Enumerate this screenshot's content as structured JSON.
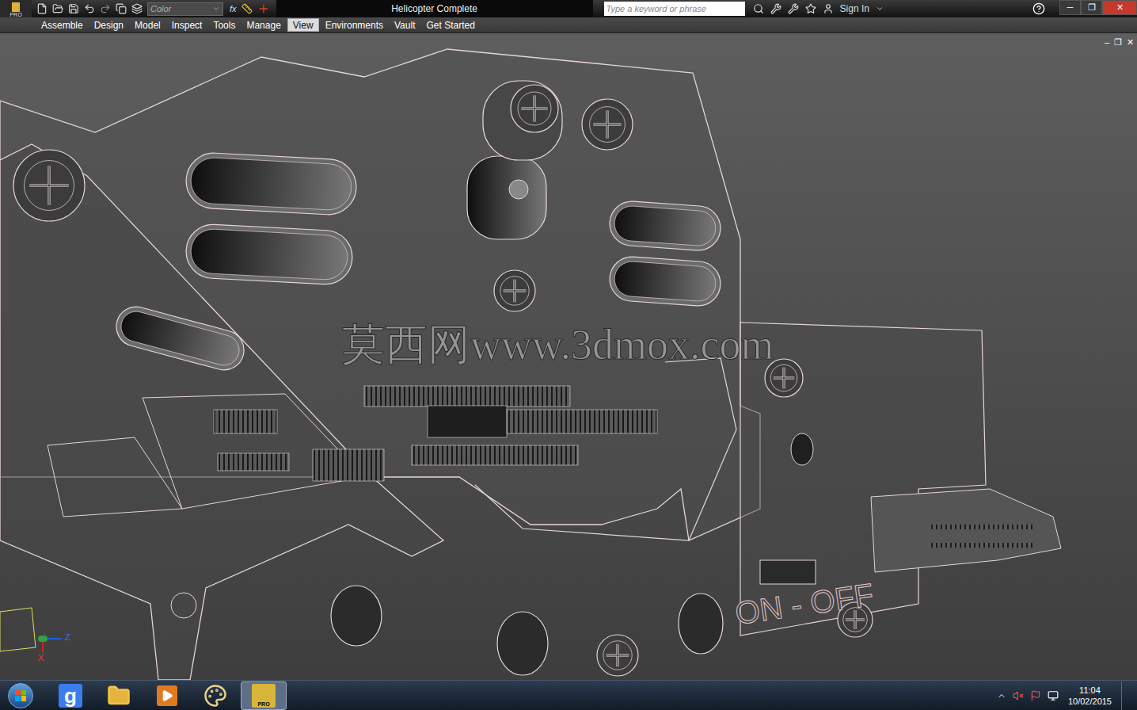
{
  "app": {
    "logo_badge": "PRO"
  },
  "quick_access": {
    "style_field": "Color",
    "formula": "fx"
  },
  "window": {
    "title": "Helicopter Complete",
    "controls": [
      "─",
      "❐",
      "✕"
    ]
  },
  "search": {
    "placeholder": "Type a keyword or phrase"
  },
  "sign_in": "Sign In",
  "ribbon_tabs": [
    {
      "label": "Assemble",
      "selected": false
    },
    {
      "label": "Design",
      "selected": false
    },
    {
      "label": "Model",
      "selected": false
    },
    {
      "label": "Inspect",
      "selected": false
    },
    {
      "label": "Tools",
      "selected": false
    },
    {
      "label": "Manage",
      "selected": false
    },
    {
      "label": "View",
      "selected": true
    },
    {
      "label": "Environments",
      "selected": false
    },
    {
      "label": "Vault",
      "selected": false
    },
    {
      "label": "Get Started",
      "selected": false
    }
  ],
  "viewport": {
    "controls": [
      "–",
      "❐",
      "✕"
    ],
    "watermark": "莫西网www.3dmox.com",
    "model_label": "ON - OFF",
    "axes": [
      "Z",
      "X"
    ]
  },
  "taskbar": {
    "apps": [
      {
        "kind": "google",
        "label": "g",
        "selected": false
      },
      {
        "kind": "explorer",
        "label": "",
        "selected": false
      },
      {
        "kind": "media",
        "label": "",
        "selected": false
      },
      {
        "kind": "paint",
        "label": "",
        "selected": false
      },
      {
        "kind": "inventor",
        "label": "PRO",
        "selected": true
      }
    ],
    "clock": {
      "time": "11:04",
      "date": "10/02/2015"
    }
  }
}
